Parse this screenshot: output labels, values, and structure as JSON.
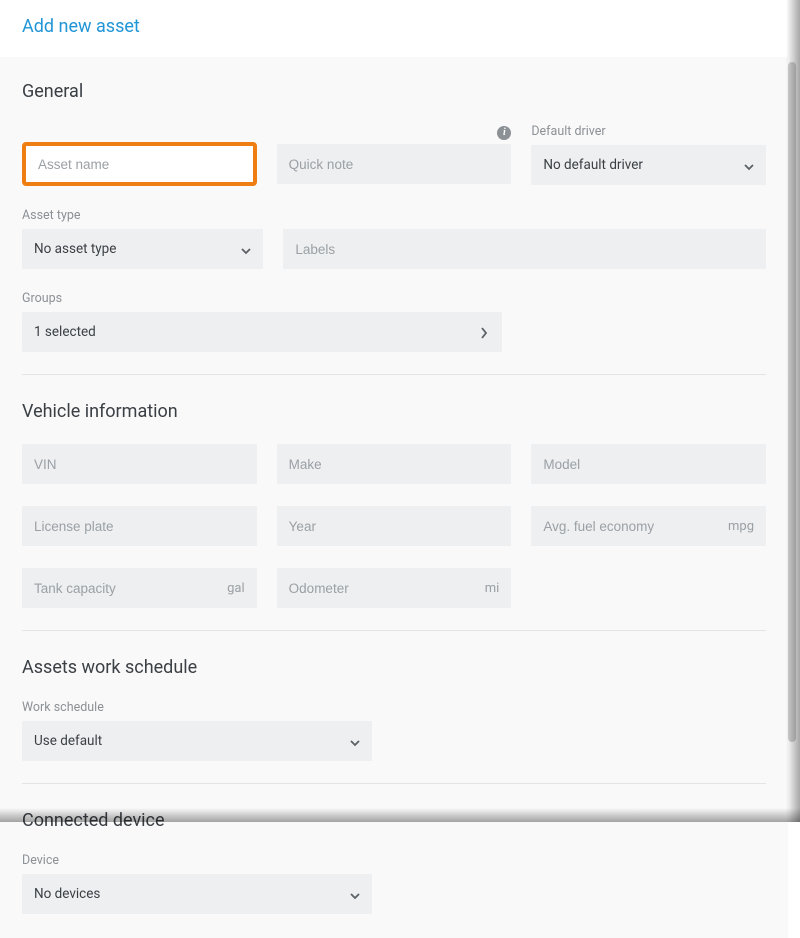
{
  "header": {
    "title": "Add new asset"
  },
  "general": {
    "heading": "General",
    "asset_name": {
      "placeholder": "Asset name",
      "value": ""
    },
    "quick_note": {
      "placeholder": "Quick note",
      "value": ""
    },
    "default_driver": {
      "label": "Default driver",
      "value": "No default driver"
    },
    "asset_type": {
      "label": "Asset type",
      "value": "No asset type"
    },
    "labels": {
      "placeholder": "Labels",
      "value": ""
    },
    "groups": {
      "label": "Groups",
      "value": "1 selected"
    }
  },
  "vehicle": {
    "heading": "Vehicle information",
    "vin": {
      "placeholder": "VIN"
    },
    "make": {
      "placeholder": "Make"
    },
    "model": {
      "placeholder": "Model"
    },
    "license_plate": {
      "placeholder": "License plate"
    },
    "year": {
      "placeholder": "Year"
    },
    "avg_fuel": {
      "placeholder": "Avg. fuel economy",
      "unit": "mpg"
    },
    "tank": {
      "placeholder": "Tank capacity",
      "unit": "gal"
    },
    "odometer": {
      "placeholder": "Odometer",
      "unit": "mi"
    }
  },
  "work_schedule": {
    "heading": "Assets work schedule",
    "label": "Work schedule",
    "value": "Use default"
  },
  "connected": {
    "heading": "Connected device",
    "label": "Device",
    "value": "No devices"
  }
}
